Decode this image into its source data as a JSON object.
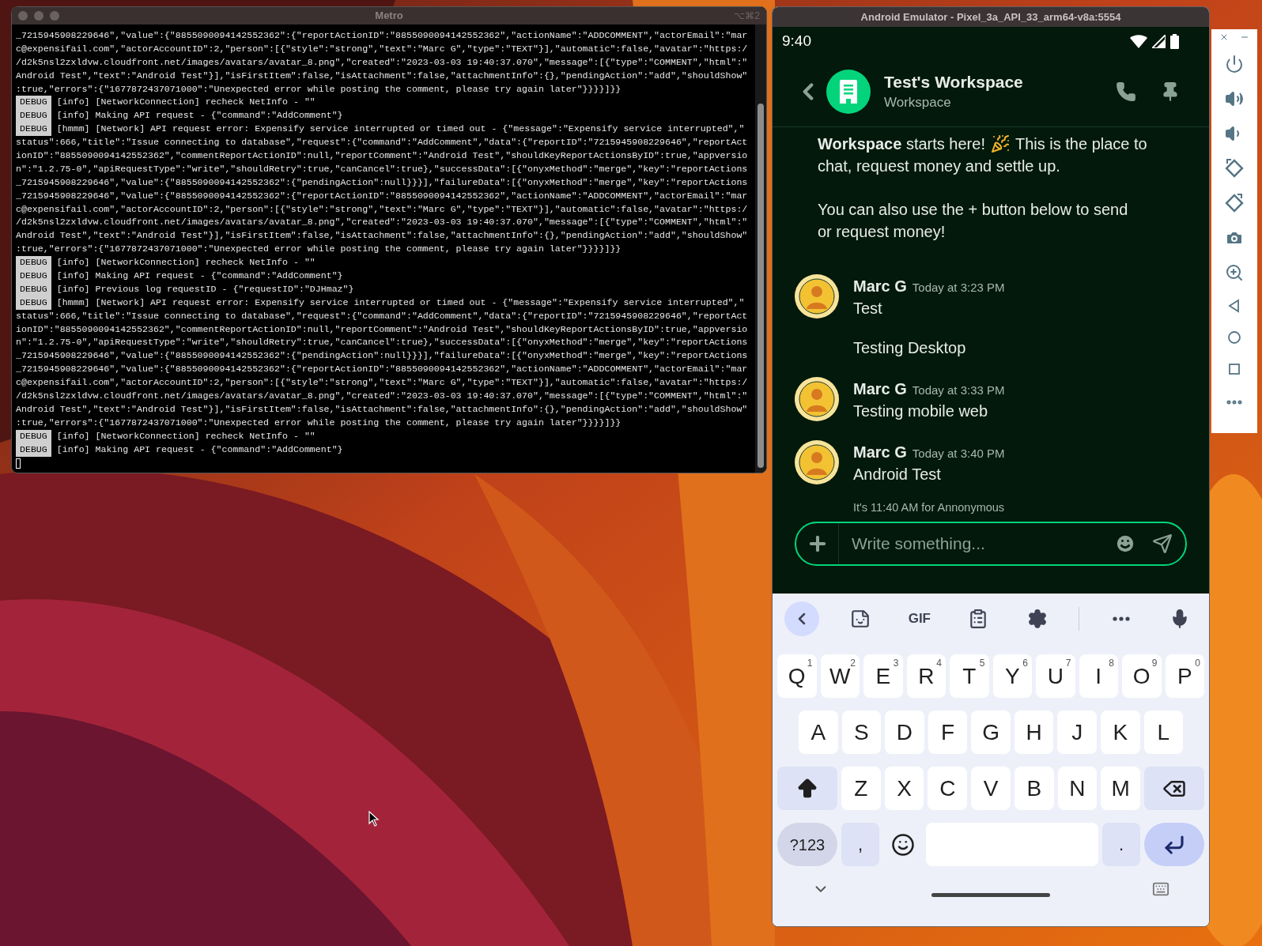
{
  "terminal": {
    "title": "Metro",
    "shortcut": "⌥⌘2",
    "lines": [
      {
        "kind": "wrap",
        "text": "_7215945908229646\",\"value\":{\"8855090094142552362\":{\"reportActionID\":\"8855090094142552362\",\"actionName\":\"ADDCOMMENT\",\"actorEmail\":\"mar"
      },
      {
        "kind": "wrap",
        "text": "c@expensifail.com\",\"actorAccountID\":2,\"person\":[{\"style\":\"strong\",\"text\":\"Marc G\",\"type\":\"TEXT\"}],\"automatic\":false,\"avatar\":\"https:/"
      },
      {
        "kind": "wrap",
        "text": "/d2k5nsl2zxldvw.cloudfront.net/images/avatars/avatar_8.png\",\"created\":\"2023-03-03 19:40:37.070\",\"message\":[{\"type\":\"COMMENT\",\"html\":\""
      },
      {
        "kind": "wrap",
        "text": "Android Test\",\"text\":\"Android Test\"}],\"isFirstItem\":false,\"isAttachment\":false,\"attachmentInfo\":{},\"pendingAction\":\"add\",\"shouldShow\""
      },
      {
        "kind": "wrap",
        "text": ":true,\"errors\":{\"1677872437071000\":\"Unexpected error while posting the comment, please try again later\"}}}}]}}"
      },
      {
        "kind": "log",
        "tag": "DEBUG",
        "text": "[info] [NetworkConnection] recheck NetInfo - \"\""
      },
      {
        "kind": "log",
        "tag": "DEBUG",
        "text": "[info] Making API request - {\"command\":\"AddComment\"}"
      },
      {
        "kind": "log",
        "tag": "DEBUG",
        "text": "[hmmm] [Network] API request error: Expensify service interrupted or timed out - {\"message\":\"Expensify service interrupted\",\""
      },
      {
        "kind": "wrap",
        "text": "status\":666,\"title\":\"Issue connecting to database\",\"request\":{\"command\":\"AddComment\",\"data\":{\"reportID\":\"7215945908229646\",\"reportAct"
      },
      {
        "kind": "wrap",
        "text": "ionID\":\"8855090094142552362\",\"commentReportActionID\":null,\"reportComment\":\"Android Test\",\"shouldKeyReportActionsByID\":true,\"appversio"
      },
      {
        "kind": "wrap",
        "text": "n\":\"1.2.75-0\",\"apiRequestType\":\"write\",\"shouldRetry\":true,\"canCancel\":true},\"successData\":[{\"onyxMethod\":\"merge\",\"key\":\"reportActions"
      },
      {
        "kind": "wrap",
        "text": "_7215945908229646\",\"value\":{\"8855090094142552362\":{\"pendingAction\":null}}}],\"failureData\":[{\"onyxMethod\":\"merge\",\"key\":\"reportActions"
      },
      {
        "kind": "wrap",
        "text": "_7215945908229646\",\"value\":{\"8855090094142552362\":{\"reportActionID\":\"8855090094142552362\",\"actionName\":\"ADDCOMMENT\",\"actorEmail\":\"mar"
      },
      {
        "kind": "wrap",
        "text": "c@expensifail.com\",\"actorAccountID\":2,\"person\":[{\"style\":\"strong\",\"text\":\"Marc G\",\"type\":\"TEXT\"}],\"automatic\":false,\"avatar\":\"https:/"
      },
      {
        "kind": "wrap",
        "text": "/d2k5nsl2zxldvw.cloudfront.net/images/avatars/avatar_8.png\",\"created\":\"2023-03-03 19:40:37.070\",\"message\":[{\"type\":\"COMMENT\",\"html\":\""
      },
      {
        "kind": "wrap",
        "text": "Android Test\",\"text\":\"Android Test\"}],\"isFirstItem\":false,\"isAttachment\":false,\"attachmentInfo\":{},\"pendingAction\":\"add\",\"shouldShow\""
      },
      {
        "kind": "wrap",
        "text": ":true,\"errors\":{\"1677872437071000\":\"Unexpected error while posting the comment, please try again later\"}}}}]}}"
      },
      {
        "kind": "log",
        "tag": "DEBUG",
        "text": "[info] [NetworkConnection] recheck NetInfo - \"\""
      },
      {
        "kind": "log",
        "tag": "DEBUG",
        "text": "[info] Making API request - {\"command\":\"AddComment\"}"
      },
      {
        "kind": "log",
        "tag": "DEBUG",
        "text": "[info] Previous log requestID - {\"requestID\":\"DJHmaz\"}"
      },
      {
        "kind": "log",
        "tag": "DEBUG",
        "text": "[hmmm] [Network] API request error: Expensify service interrupted or timed out - {\"message\":\"Expensify service interrupted\",\""
      },
      {
        "kind": "wrap",
        "text": "status\":666,\"title\":\"Issue connecting to database\",\"request\":{\"command\":\"AddComment\",\"data\":{\"reportID\":\"7215945908229646\",\"reportAct"
      },
      {
        "kind": "wrap",
        "text": "ionID\":\"8855090094142552362\",\"commentReportActionID\":null,\"reportComment\":\"Android Test\",\"shouldKeyReportActionsByID\":true,\"appversio"
      },
      {
        "kind": "wrap",
        "text": "n\":\"1.2.75-0\",\"apiRequestType\":\"write\",\"shouldRetry\":true,\"canCancel\":true},\"successData\":[{\"onyxMethod\":\"merge\",\"key\":\"reportActions"
      },
      {
        "kind": "wrap",
        "text": "_7215945908229646\",\"value\":{\"8855090094142552362\":{\"pendingAction\":null}}}],\"failureData\":[{\"onyxMethod\":\"merge\",\"key\":\"reportActions"
      },
      {
        "kind": "wrap",
        "text": "_7215945908229646\",\"value\":{\"8855090094142552362\":{\"reportActionID\":\"8855090094142552362\",\"actionName\":\"ADDCOMMENT\",\"actorEmail\":\"mar"
      },
      {
        "kind": "wrap",
        "text": "c@expensifail.com\",\"actorAccountID\":2,\"person\":[{\"style\":\"strong\",\"text\":\"Marc G\",\"type\":\"TEXT\"}],\"automatic\":false,\"avatar\":\"https:/"
      },
      {
        "kind": "wrap",
        "text": "/d2k5nsl2zxldvw.cloudfront.net/images/avatars/avatar_8.png\",\"created\":\"2023-03-03 19:40:37.070\",\"message\":[{\"type\":\"COMMENT\",\"html\":\""
      },
      {
        "kind": "wrap",
        "text": "Android Test\",\"text\":\"Android Test\"}],\"isFirstItem\":false,\"isAttachment\":false,\"attachmentInfo\":{},\"pendingAction\":\"add\",\"shouldShow\""
      },
      {
        "kind": "wrap",
        "text": ":true,\"errors\":{\"1677872437071000\":\"Unexpected error while posting the comment, please try again later\"}}}}]}}"
      },
      {
        "kind": "log",
        "tag": "DEBUG",
        "text": "[info] [NetworkConnection] recheck NetInfo - \"\""
      },
      {
        "kind": "log",
        "tag": "DEBUG",
        "text": "[info] Making API request - {\"command\":\"AddComment\"}"
      }
    ]
  },
  "emulator": {
    "title": "Android Emulator - Pixel_3a_API_33_arm64-v8a:5554",
    "status_time": "9:40",
    "chat": {
      "title": "Test's Workspace",
      "subtitle": "Workspace",
      "welcome": [
        {
          "lines": [
            {
              "kind": "emoji",
              "text": "**Workspace** starts here!",
              "rest": "This is the place to"
            },
            {
              "kind": "plain",
              "text": "chat, request money and settle up."
            }
          ]
        },
        {
          "lines": [
            {
              "kind": "plain",
              "text": "You can also use the + button below to send"
            },
            {
              "kind": "plain",
              "text": "or request money!"
            }
          ]
        }
      ],
      "messages": [
        {
          "author": "Marc G",
          "time": "Today at 3:23 PM",
          "texts": [
            "Test",
            "Testing Desktop"
          ]
        },
        {
          "author": "Marc G",
          "time": "Today at 3:33 PM",
          "texts": [
            "Testing mobile web"
          ]
        },
        {
          "author": "Marc G",
          "time": "Today at 3:40 PM",
          "texts": [
            "Android Test"
          ]
        }
      ],
      "local_time": "It's 11:40 AM for Annonymous",
      "composer": {
        "placeholder": "Write something..."
      }
    },
    "keyboard": {
      "toolbar": [
        {
          "kind": "back",
          "selected": true
        },
        {
          "kind": "sticker",
          "selected": false
        },
        {
          "kind": "text",
          "label": "GIF",
          "selected": false
        },
        {
          "kind": "clipboard",
          "selected": false
        },
        {
          "kind": "settings",
          "selected": false
        },
        {
          "kind": "more",
          "selected": false
        },
        {
          "kind": "mic",
          "selected": false
        }
      ],
      "rows": [
        {
          "keys": [
            {
              "kind": "letter",
              "label": "Q",
              "hint": "1"
            },
            {
              "kind": "letter",
              "label": "W",
              "hint": "2"
            },
            {
              "kind": "letter",
              "label": "E",
              "hint": "3"
            },
            {
              "kind": "letter",
              "label": "R",
              "hint": "4"
            },
            {
              "kind": "letter",
              "label": "T",
              "hint": "5"
            },
            {
              "kind": "letter",
              "label": "Y",
              "hint": "6"
            },
            {
              "kind": "letter",
              "label": "U",
              "hint": "7"
            },
            {
              "kind": "letter",
              "label": "I",
              "hint": "8"
            },
            {
              "kind": "letter",
              "label": "O",
              "hint": "9"
            },
            {
              "kind": "letter",
              "label": "P",
              "hint": "0"
            }
          ]
        },
        {
          "keys": [
            {
              "kind": "letter",
              "label": "A"
            },
            {
              "kind": "letter",
              "label": "S"
            },
            {
              "kind": "letter",
              "label": "D"
            },
            {
              "kind": "letter",
              "label": "F"
            },
            {
              "kind": "letter",
              "label": "G"
            },
            {
              "kind": "letter",
              "label": "H"
            },
            {
              "kind": "letter",
              "label": "J"
            },
            {
              "kind": "letter",
              "label": "K"
            },
            {
              "kind": "letter",
              "label": "L"
            }
          ]
        },
        {
          "keys": [
            {
              "kind": "shift"
            },
            {
              "kind": "letter",
              "label": "Z"
            },
            {
              "kind": "letter",
              "label": "X"
            },
            {
              "kind": "letter",
              "label": "C"
            },
            {
              "kind": "letter",
              "label": "V"
            },
            {
              "kind": "letter",
              "label": "B"
            },
            {
              "kind": "letter",
              "label": "N"
            },
            {
              "kind": "letter",
              "label": "M"
            },
            {
              "kind": "backspace"
            }
          ]
        },
        {
          "keys": [
            {
              "kind": "symbols",
              "label": "?123"
            },
            {
              "kind": "punct",
              "label": ","
            },
            {
              "kind": "emoji"
            },
            {
              "kind": "space"
            },
            {
              "kind": "punct",
              "label": "."
            },
            {
              "kind": "enter"
            }
          ]
        }
      ]
    }
  }
}
